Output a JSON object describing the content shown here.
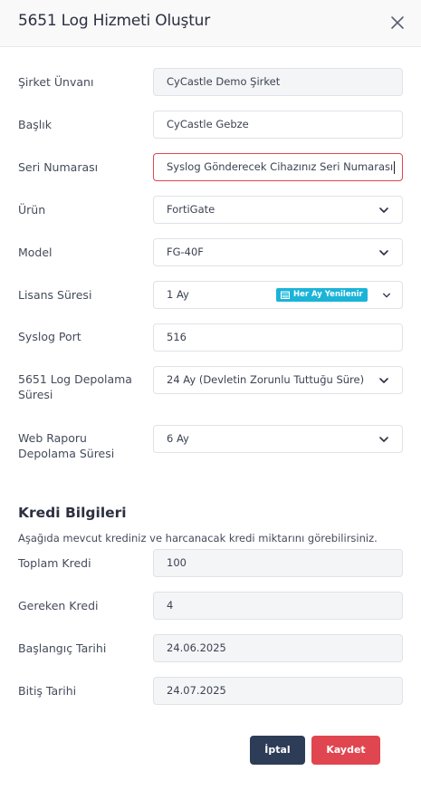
{
  "dialog": {
    "title": "5651 Log Hizmeti Oluştur"
  },
  "form": {
    "company": {
      "label": "Şirket Ünvanı",
      "value": "CyCastle Demo Şirket"
    },
    "heading": {
      "label": "Başlık",
      "value": "CyCastle Gebze"
    },
    "serial": {
      "label": "Seri Numarası",
      "value": "Syslog Gönderecek Cihazınız Seri Numarası"
    },
    "product": {
      "label": "Ürün",
      "value": "FortiGate"
    },
    "model": {
      "label": "Model",
      "value": "FG-40F"
    },
    "license": {
      "label": "Lisans Süresi",
      "value": "1 Ay",
      "badge": "Her Ay Yenilenir"
    },
    "syslog_port": {
      "label": "Syslog Port",
      "value": "516"
    },
    "log_storage": {
      "label_line1": "5651 Log Depolama",
      "label_line2": "Süresi",
      "value": "24 Ay (Devletin Zorunlu Tuttuğu Süre)"
    },
    "web_report": {
      "label_line1": "Web Raporu",
      "label_line2": "Depolama Süresi",
      "value": "6 Ay"
    }
  },
  "credit": {
    "title": "Kredi Bilgileri",
    "description": "Aşağıda mevcut krediniz ve harcanacak kredi miktarını görebilirsiniz.",
    "total": {
      "label": "Toplam Kredi",
      "value": "100"
    },
    "required": {
      "label": "Gereken Kredi",
      "value": "4"
    },
    "start_date": {
      "label": "Başlangıç Tarihi",
      "value": "24.06.2025"
    },
    "end_date": {
      "label": "Bitiş Tarihi",
      "value": "24.07.2025"
    }
  },
  "actions": {
    "cancel_label": "İptal",
    "save_label": "Kaydet"
  },
  "colors": {
    "primary_dark": "#2e3d57",
    "danger": "#e0464f",
    "badge": "#1bb4d8"
  }
}
